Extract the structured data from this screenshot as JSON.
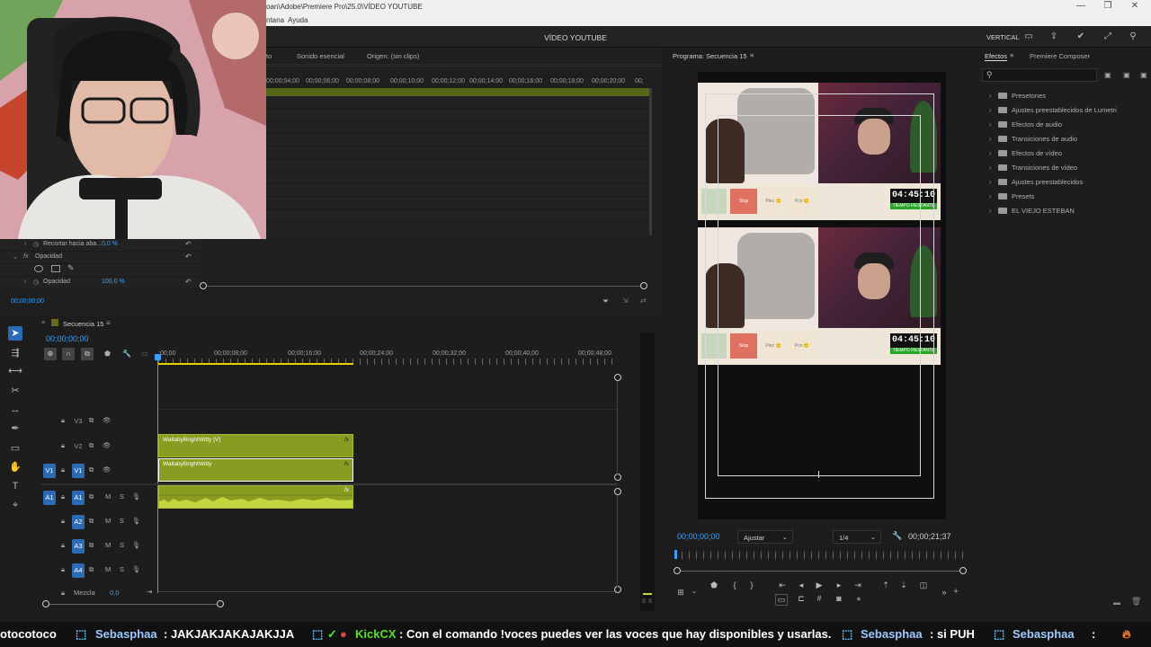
{
  "titlebar": {
    "path": "oan\\Adobe\\Premiere Pro\\25.0\\VÍDEO YOUTUBE",
    "controls": [
      "—",
      "❐",
      "✕"
    ]
  },
  "menubar": {
    "items": [
      "ntana",
      "Ayuda"
    ]
  },
  "workspace": {
    "title": "VÍDEO YOUTUBE",
    "mode": "VERTICAL"
  },
  "source": {
    "tabs": [
      "to",
      "Sonido esencial",
      "Origen: (sin clips)"
    ],
    "ruler": [
      "00;00;04;00",
      "00;00;06;00",
      "00;00;08;00",
      "00;00;10;00",
      "00;00;12;00",
      "00;00;14;00",
      "00;00;16;00",
      "00;00;18;00",
      "00;00;20;00",
      "00;"
    ],
    "fx_rows": {
      "recortar_label": "Recortar hacia aba...",
      "recortar_value": "0,0 %",
      "opacidad_group": "Opacidad",
      "opacidad_label": "Opacidad",
      "opacidad_value": "100,0 %"
    },
    "timecode": "00;00;00;00"
  },
  "program": {
    "title": "Programa: Secuencia 15",
    "timecode": "00;00;00;00",
    "fit": "Ajustar",
    "resolution": "1/4",
    "duration": "00;00;21;37",
    "video": {
      "clock": "04:45:10",
      "clock_label": "TIEMPO RESTANTE",
      "btn_red": "Stop",
      "btn_a": "Piez 🙂",
      "btn_b": "Pcn 🙂"
    }
  },
  "effects": {
    "tabs": [
      "Efectos",
      "Premiere Composer"
    ],
    "items": [
      "Presetones",
      "Ajustes preestablecidos de Lumetri",
      "Efectos de audio",
      "Transiciones de audio",
      "Efectos de vídeo",
      "Transiciones de vídeo",
      "Ajustes preestablecidos",
      "Presets",
      "EL VIEJO ESTEBAN"
    ]
  },
  "timeline": {
    "tab": "Secuencia 15",
    "timecode": "00;00;00;00",
    "ruler": [
      ":00;00",
      "00;00;08;00",
      "00;00;16;00",
      "00;00;24;00",
      "00;00;32;00",
      "00;00;40;00",
      "00;00;48;00"
    ],
    "video_tracks": [
      "V3",
      "V2",
      "V1"
    ],
    "source_patch_v": "V1",
    "audio_tracks": [
      "A1",
      "A2",
      "A3",
      "A4"
    ],
    "source_patch_a": "A1",
    "clip_v2": "WallabyBrightWitty [V]",
    "clip_v1": "WallabyBrightWitty",
    "fx_label": "fx",
    "mezcla_label": "Mezcla",
    "mezcla_value": "0,0"
  },
  "meter": {
    "labels": [
      "S",
      "S"
    ]
  },
  "ticker": {
    "prefix": "otocotoco",
    "user1": "Sebasphaa",
    "msg1": ": JAKJAKJAKAJAKJJA",
    "user2": "KickCX",
    "msg2": ": Con el comando !voces puedes ver las voces que hay disponibles y usarlas.",
    "user3": "Sebasphaa",
    "msg3": ": si PUH",
    "user4": "Sebasphaa",
    "msg4": ":"
  },
  "colors": {
    "accent": "#2d6ab4",
    "timecode": "#3aa0ff",
    "clip_video": "#8a9b22",
    "clip_audio": "#8a9b22",
    "playhead_range": "#e8d000"
  }
}
